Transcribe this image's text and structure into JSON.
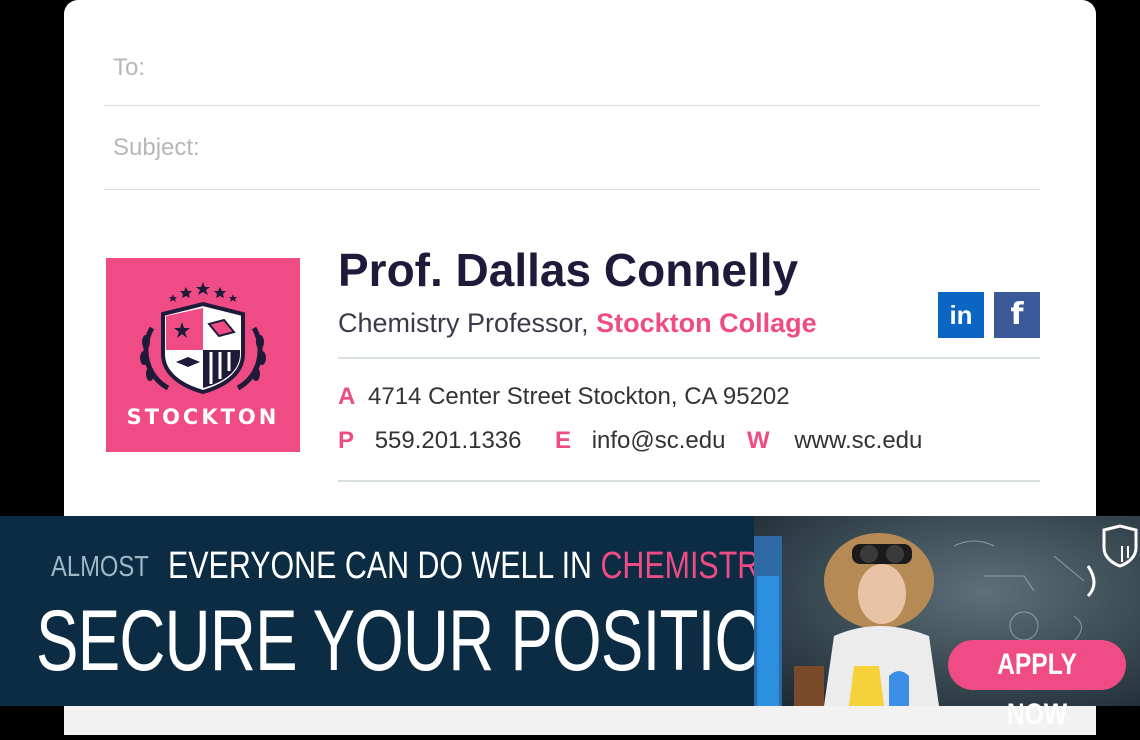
{
  "email": {
    "to_label": "To:",
    "subject_label": "Subject:"
  },
  "signature": {
    "logo_text": "STOCKTON",
    "name": "Prof. Dallas Connelly",
    "title": "Chemistry Professor,",
    "organization": "Stockton Collage",
    "social": [
      {
        "icon": "linkedin-icon",
        "label": "in",
        "color": "#0a66c2"
      },
      {
        "icon": "facebook-icon",
        "label": "f",
        "color": "#3b5998"
      }
    ],
    "address_key": "A",
    "address": "4714 Center Street Stockton, CA 95202",
    "phone_key": "P",
    "phone": "559.201.1336",
    "email_key": "E",
    "email": "info@sc.edu",
    "web_key": "W",
    "web": "www.sc.edu",
    "accent_color": "#ef4b84",
    "name_color": "#1e1b3a"
  },
  "banner": {
    "almost": "ALMOST",
    "headline_main": "EVERYONE CAN DO WELL IN",
    "headline_accent": "CHEMISTRY",
    "secure": "SECURE YOUR POSITION",
    "apply": "APPLY NOW",
    "background_color": "#0c2c43"
  }
}
